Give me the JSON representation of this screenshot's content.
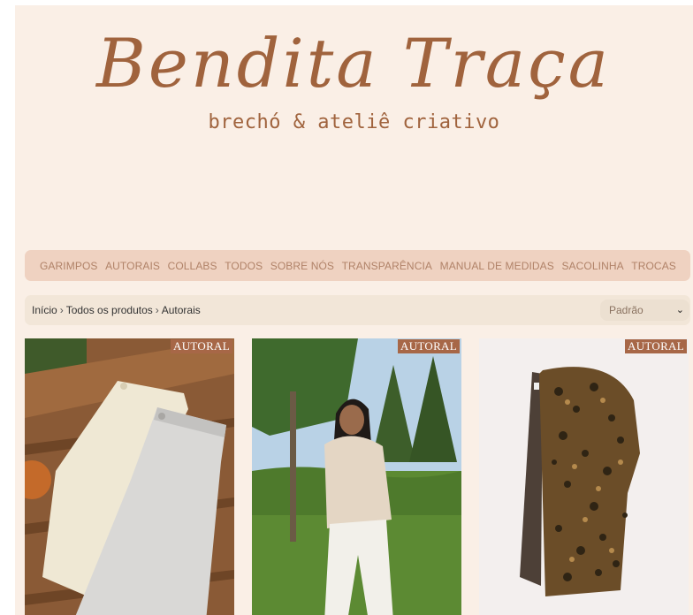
{
  "brand": {
    "name": "Bendita Traça",
    "tagline": "brechó & ateliê criativo"
  },
  "nav": {
    "items": [
      {
        "label": "GARIMPOS"
      },
      {
        "label": "AUTORAIS"
      },
      {
        "label": "COLLABS"
      },
      {
        "label": "TODOS"
      },
      {
        "label": "SOBRE NÓS"
      },
      {
        "label": "TRANSPARÊNCIA"
      },
      {
        "label": "MANUAL DE MEDIDAS"
      },
      {
        "label": "SACOLINHA"
      },
      {
        "label": "TROCAS"
      }
    ]
  },
  "breadcrumb": {
    "items": [
      "Início",
      "Todos os produtos",
      "Autorais"
    ],
    "separator": "›"
  },
  "sort": {
    "selected": "Padrão"
  },
  "products": [
    {
      "badge": "AUTORAL",
      "image": "trousers-on-wooden-table"
    },
    {
      "badge": "AUTORAL",
      "image": "woman-in-field-with-pine-trees"
    },
    {
      "badge": "AUTORAL",
      "image": "leopard-print-fur-jacket"
    }
  ],
  "colors": {
    "background": "#faefe6",
    "brand": "#a0633d",
    "nav_bg": "#efd2c1",
    "badge": "#a76747"
  }
}
